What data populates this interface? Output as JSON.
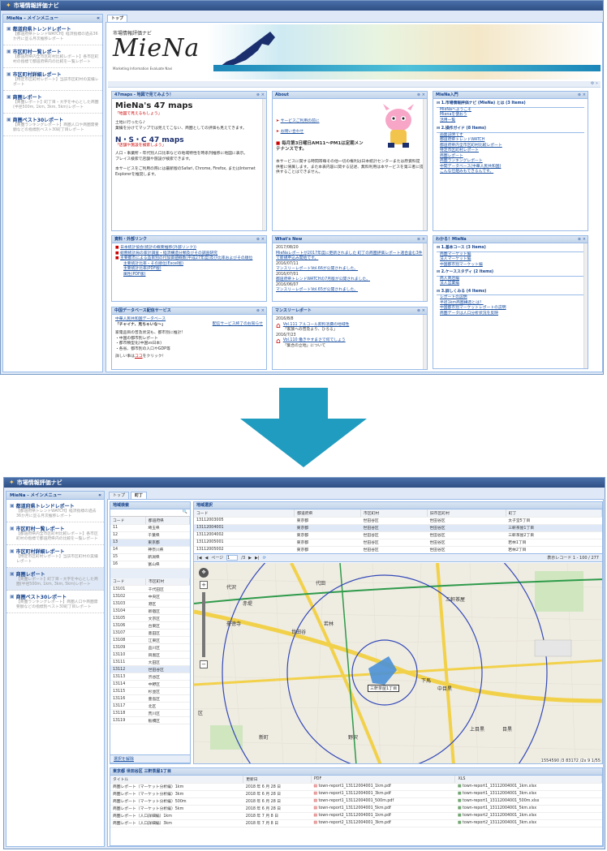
{
  "app_title": "市場情報評価ナビ",
  "top_app_title": "市場情報評価ナビ",
  "sidebar": {
    "title": "MieNa - メインメニュー",
    "items": [
      {
        "title": "都道府県トレンドレポート",
        "desc": "【都道府県トレンドWATCH】経済指標の過去36か月に亘る月次推移レポート"
      },
      {
        "title": "市区町村一覧レポート",
        "desc": "【都道府県内全市区町村比較レポート】各市区町村の指標で都道府県内の比較を一覧レポート"
      },
      {
        "title": "市区町村詳細レポート",
        "desc": "【特定市区町村レポート】当該市区町村の実績レポート"
      },
      {
        "title": "商圏レポート",
        "desc": "【商圏レポート】町丁目・大字を中心とした商圏(半径500m, 1km, 3km, 5km)レポート"
      },
      {
        "title": "商圏ベスト30レポート",
        "desc": "【商圏ランキングレポート】商圏人口や商圏需要額などの指標別ベスト30町丁目レポート"
      }
    ]
  },
  "top": {
    "tab_label": "トップ",
    "banner_subtitle": "市場情報評価ナビ",
    "banner_logo": "MieNa",
    "banner_tagline": "Marketing Information Evaluate Navi",
    "portlets": {
      "p47": {
        "title": "47maps - 地図で見てみよう！",
        "logo1": "MieNa's 47 maps",
        "caption1": "「地図で見えるもしょう」",
        "text1": "土地に行ったら♪",
        "text2": "業績を分けてマップでは見えてこない、商圏としての評価も見えてきます。",
        "logo2": "N・S・C 47 maps",
        "caption2": "「店舗や施設を検索しよう」",
        "text3": "人口・事業所・年代別人口比率などの地域特性を時系列推移に地図に表示。",
        "text4": "プレイス検索で店舗や施設が検索できます。",
        "text5": "本サービスをご利用の際には最新版のSafari, Chrome, Firefox, またはInternet Explorerを推奨します。"
      },
      "about": {
        "title": "About",
        "link1": "サービスご利用の前に",
        "link2": "お問い合わせ",
        "notice": "毎月第3日曜日AM11〜PM1は定期メンテナンスです。",
        "text": "本サービスに関する時間帯毎その他一切の権利は日本統計センターまたは原資料提供者に帰属します。また本表内容に関する記述、無料利用は本サービスを第三者に提供することはできません。"
      },
      "intro": {
        "title": "MieNa入門",
        "header1": "1.市場情報評価ナビ (MieNa) とは (3 Items)",
        "items1": [
          "MieNaへようこそ",
          "Mienaを使おう",
          "活用一覧"
        ],
        "header2": "2.操作ガイド (8 Items)",
        "items2": [
          "画面説明です",
          "都道府県トレンドWATCH",
          "都道府県内全市区町村比較レポート",
          "特定市区町村レポート",
          "商圏レポート",
          "商圏ランキングレポート",
          "中間データベース(中華人民共和国)",
          "こんな仕組みもできるんです。"
        ]
      },
      "links": {
        "title": "資料・外部リンク",
        "items": [
          "日本統計協会(統計の概要推移(外部リンク))",
          "総務統計局の家計調査・経済構造分類及びその調査研究",
          "主要都市による品目別の付加価値概数(平成27年度)及び比率およびその順位",
          "主要統計比率・その順位(Excel版)",
          "主要統計比率(PDF版)",
          "属性(PDF版)"
        ]
      },
      "whatsnew": {
        "title": "What's New",
        "items": [
          {
            "date": "2017/08/20",
            "text": "MieNaレポートが2017年度に更新されました 町丁の商圏評価レポート適合含む3件で新規申込み開始です。"
          },
          {
            "date": "2016/07/11",
            "text": "マンスリーレポートVol.66が公開されました。"
          },
          {
            "date": "2016/07/01",
            "text": "都道府県トレンドWATCHの7月版が公開されました。"
          },
          {
            "date": "2016/06/07",
            "text": "マンスリーレポートVol.65が公開されました。"
          }
        ]
      },
      "wakaru": {
        "title": "わかる！MieNa",
        "header1": "1.基本コース (3 Items)",
        "items1": [
          "商圏マーケット編",
          "法人マーケット編",
          "中国都市別マーケット編"
        ],
        "header2": "2.ケーススタディ (2 Items)",
        "items2": [
          "商人商店編",
          "法人営業編"
        ],
        "header3": "3.詳しくみる (4 Items)",
        "items3": [
          "レポートの説明",
          "半径1km商圏構造とは？",
          "中国都市別マーケットレポートの説明",
          "商圏データは人口分析状況を反映"
        ]
      },
      "chinadb": {
        "title": "中国データベース配信サービス",
        "link": "中華人民共和国データベース",
        "quote": "「チャイナ、見ちゃいな〜」",
        "text": "家電品目の普及状況も、都市別に推計!\n・中国の都市別レポート\n・都市類型化(中国vs日本)\n・各省、都市別の人口やGDP等",
        "more": "詳しい事は",
        "here": "ココ",
        "tail": "をクリック！",
        "stop": "配信サービス終了のお知らせ"
      },
      "monthly": {
        "title": "マンスリーレポート",
        "items": [
          {
            "date": "2016/8/8",
            "link": "Vol.111 アルコール飲料消費の地域性",
            "sub": "「家族への普及より、ひろる」"
          },
          {
            "date": "2016/7/23",
            "link": "Vol.110 働きやすまさで何でしょう",
            "sub": "「集合の立地」について"
          }
        ]
      }
    }
  },
  "bottom": {
    "tab_top": "トップ",
    "tab_active": "町丁",
    "region_search": {
      "title": "地域検索",
      "pref_cols": [
        "コード",
        "都道府県"
      ],
      "prefs": [
        [
          "11",
          "埼玉県"
        ],
        [
          "12",
          "千葉県"
        ],
        [
          "13",
          "東京都"
        ],
        [
          "14",
          "神奈川県"
        ],
        [
          "15",
          "新潟県"
        ],
        [
          "16",
          "富山県"
        ]
      ],
      "city_cols": [
        "コード",
        "市区町村"
      ],
      "cities": [
        [
          "13101",
          "千代田区"
        ],
        [
          "13102",
          "中央区"
        ],
        [
          "13103",
          "港区"
        ],
        [
          "13104",
          "新宿区"
        ],
        [
          "13105",
          "文京区"
        ],
        [
          "13106",
          "台東区"
        ],
        [
          "13107",
          "墨田区"
        ],
        [
          "13108",
          "江東区"
        ],
        [
          "13109",
          "品川区"
        ],
        [
          "13110",
          "目黒区"
        ],
        [
          "13111",
          "大田区"
        ],
        [
          "13112",
          "世田谷区"
        ],
        [
          "13113",
          "渋谷区"
        ],
        [
          "13114",
          "中野区"
        ],
        [
          "13115",
          "杉並区"
        ],
        [
          "13116",
          "豊島区"
        ],
        [
          "13117",
          "北区"
        ],
        [
          "13118",
          "荒川区"
        ],
        [
          "13119",
          "板橋区"
        ]
      ],
      "clear": "選択を解除"
    },
    "area_select": {
      "title": "地域選択",
      "cols": [
        "コード",
        "都道府県",
        "市区町村",
        "旧市区町村",
        "町丁"
      ],
      "rows": [
        [
          "13112003005",
          "東京都",
          "世田谷区",
          "世田谷区",
          "太子堂5丁目"
        ],
        [
          "13112004001",
          "東京都",
          "世田谷区",
          "世田谷区",
          "三軒茶屋1丁目"
        ],
        [
          "13112004002",
          "東京都",
          "世田谷区",
          "世田谷区",
          "三軒茶屋2丁目"
        ],
        [
          "13112005001",
          "東京都",
          "世田谷区",
          "世田谷区",
          "若林1丁目"
        ],
        [
          "13112005002",
          "東京都",
          "世田谷区",
          "世田谷区",
          "若林2丁目"
        ],
        [
          "13112005003",
          "東京都",
          "世田谷区",
          "世田谷区",
          "若林3丁目"
        ]
      ],
      "pager_label": "ページ",
      "page_value": "1",
      "page_total": "/3",
      "display": "表示レコード 1 - 100 / 277"
    },
    "map": {
      "label_center": "三軒茶屋1丁目",
      "places": [
        "代沢",
        "代田",
        "赤堤",
        "若林",
        "豪徳寺",
        "世田谷",
        "三軒茶屋",
        "下馬",
        "中目黒",
        "上目黒",
        "目黒",
        "野沢",
        "新町",
        "区"
      ],
      "scale": "1554590 /3 83172 /2x 9 1/55"
    },
    "results": {
      "title": "東京都 世田谷区 三軒茶屋1丁目",
      "cols": [
        "タイトル",
        "更新日",
        "PDF",
        "XLS"
      ],
      "rows": [
        [
          "商圏レポート（マーケット分析編）1km",
          "2018 年 6 月 28 日",
          "town-report1_13112004001_1km.pdf",
          "town-report1_13112004001_1km.xlsx"
        ],
        [
          "商圏レポート（マーケット分析編）3km",
          "2018 年 6 月 28 日",
          "town-report1_13112004001_3km.pdf",
          "town-report1_13112004001_3km.xlsx"
        ],
        [
          "商圏レポート（マーケット分析編）500m",
          "2018 年 6 月 28 日",
          "town-report1_13112004001_500m.pdf",
          "town-report1_13112004001_500m.xlsx"
        ],
        [
          "商圏レポート（マーケット分析編）5km",
          "2018 年 6 月 28 日",
          "town-report1_13112004001_5km.pdf",
          "town-report1_13112004001_5km.xlsx"
        ],
        [
          "商圏レポート（人口詳細編）1km",
          "2018 年 7 月 8 日",
          "town-report2_13112004001_1km.pdf",
          "town-report2_13112004001_1km.xlsx"
        ],
        [
          "商圏レポート（人口詳細編）3km",
          "2018 年 7 月 8 日",
          "town-report2_13112004001_3km.pdf",
          "town-report2_13112004001_3km.xlsx"
        ]
      ]
    }
  },
  "colors": {
    "arrow": "#1f9cc0",
    "title_bar": "#2d4f85",
    "panel_header": "#c3d4ea"
  }
}
